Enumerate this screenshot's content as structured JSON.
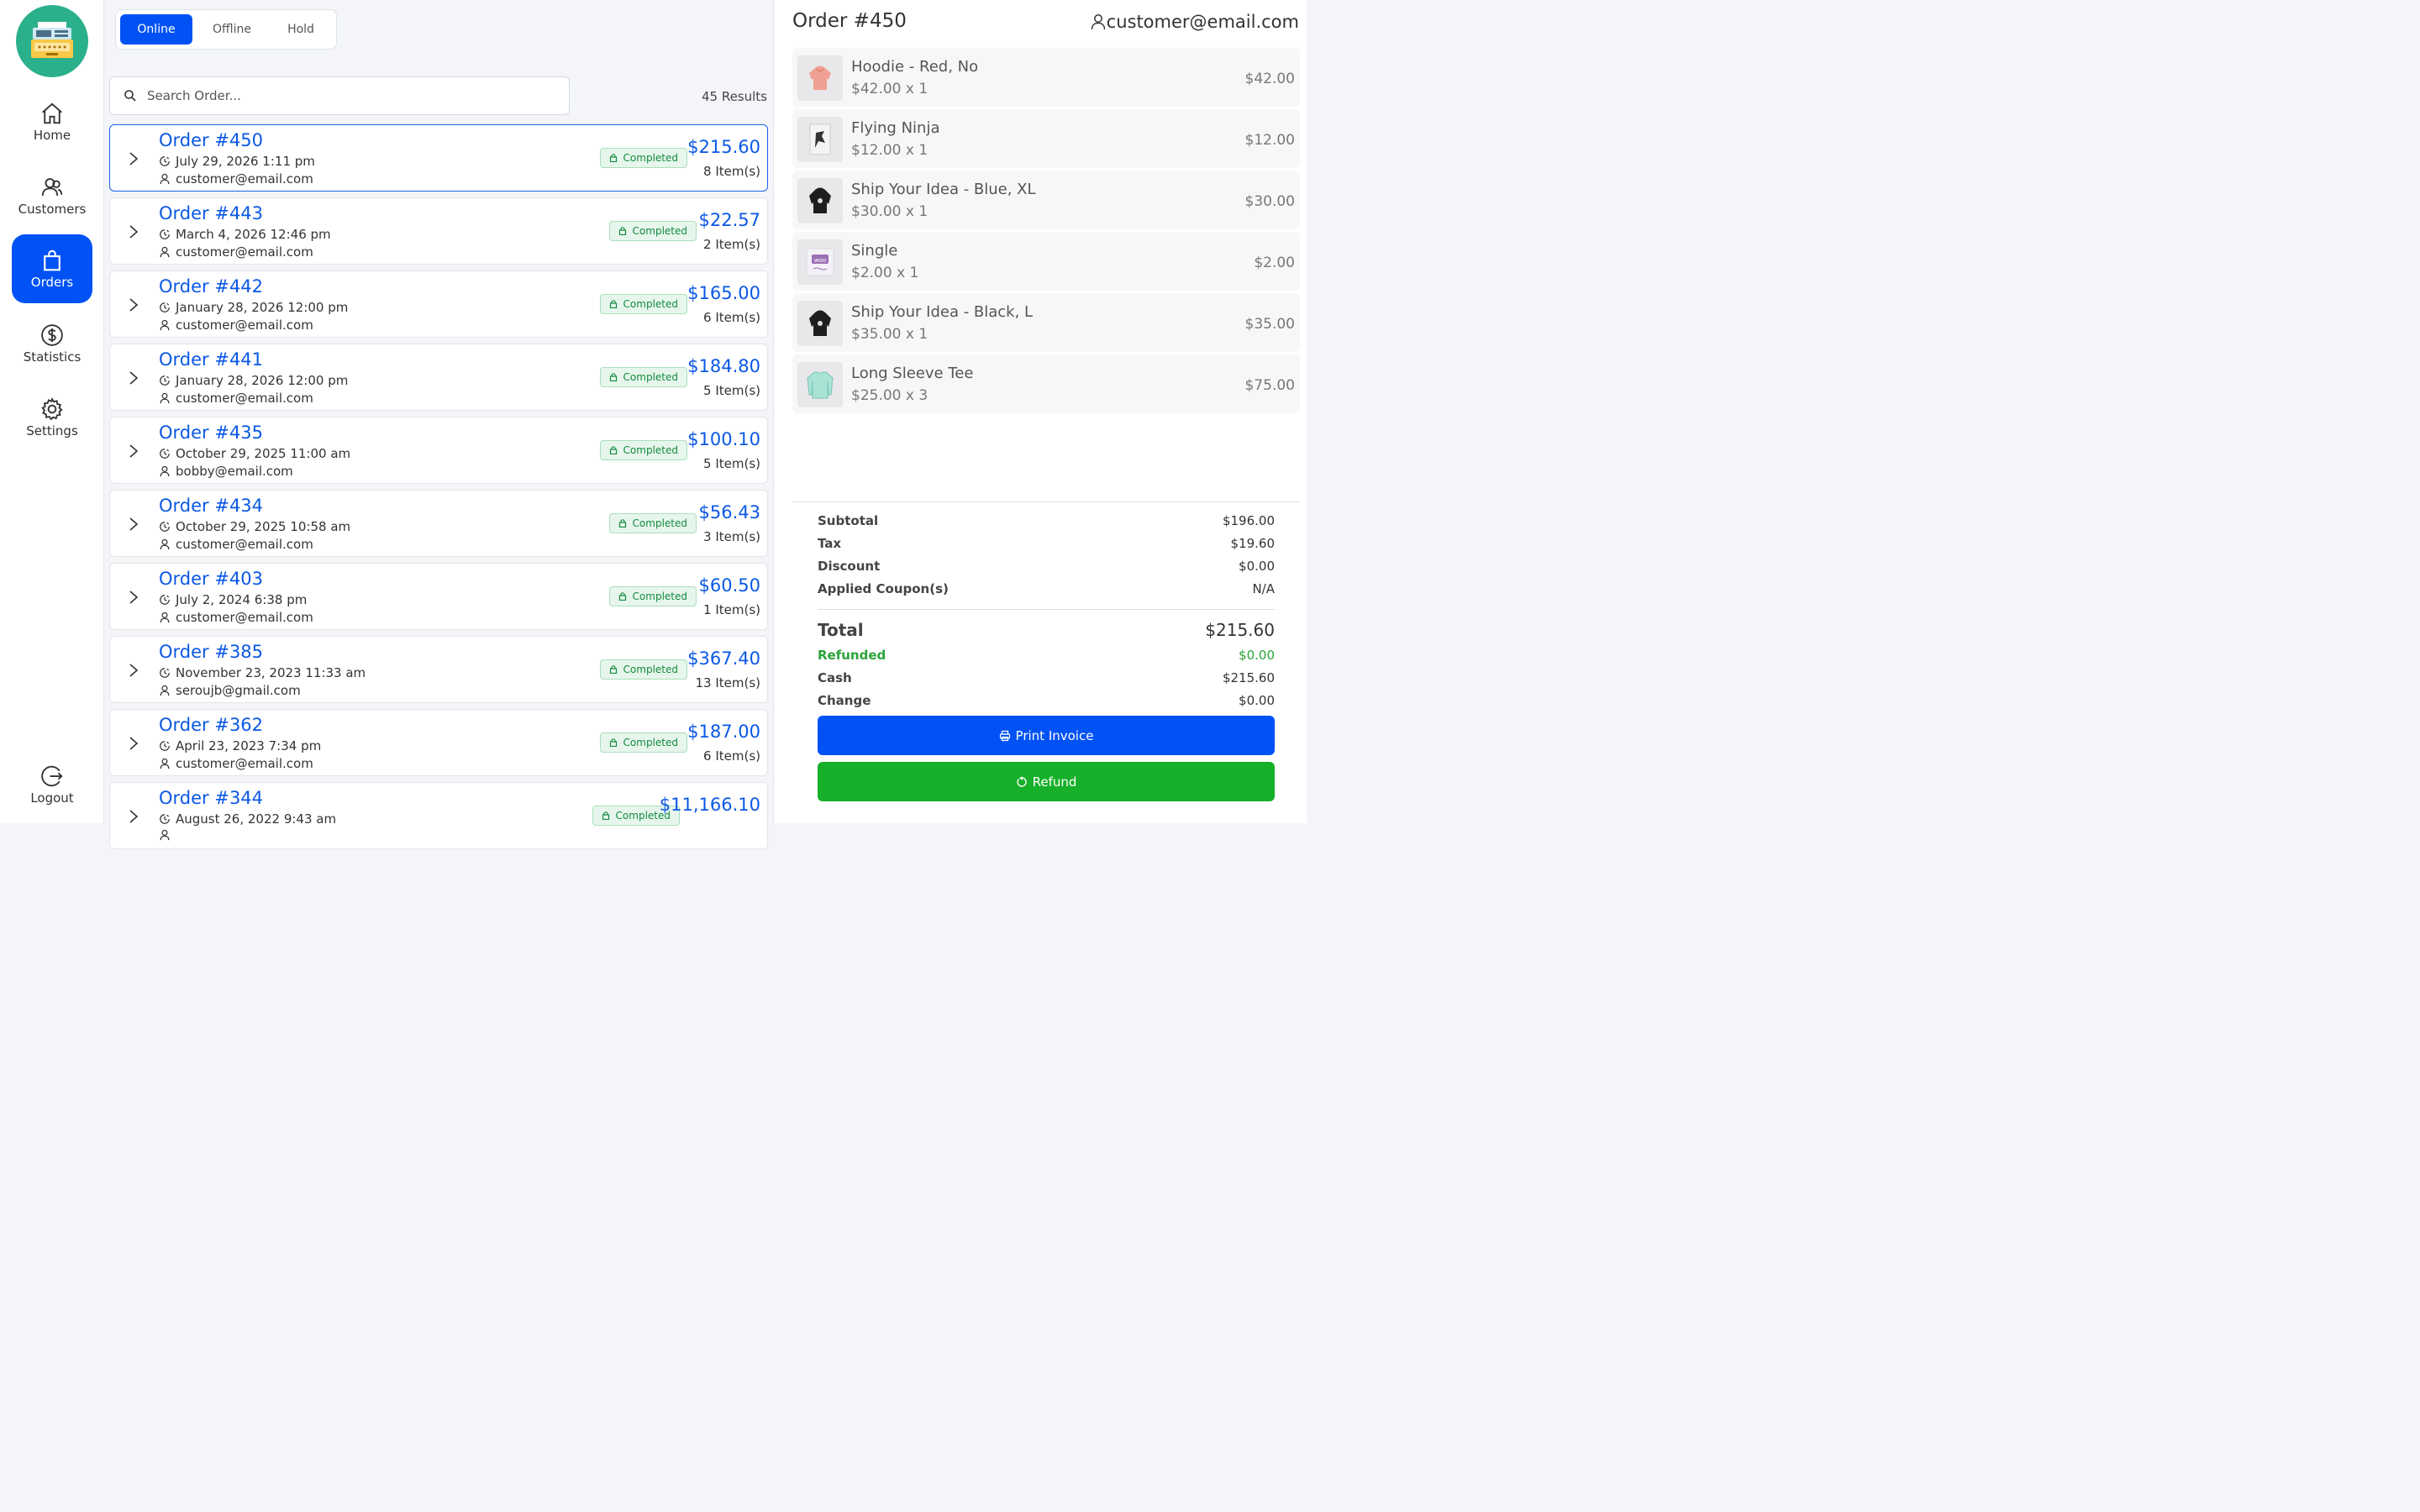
{
  "sidebar": {
    "items": [
      {
        "label": "Home",
        "icon": "home-icon"
      },
      {
        "label": "Customers",
        "icon": "users-icon"
      },
      {
        "label": "Orders",
        "icon": "bag-icon"
      },
      {
        "label": "Statistics",
        "icon": "dollar-icon"
      },
      {
        "label": "Settings",
        "icon": "gear-icon"
      }
    ],
    "logout": {
      "label": "Logout",
      "icon": "logout-icon"
    }
  },
  "tabs": [
    "Online",
    "Offline",
    "Hold"
  ],
  "active_tab": "Online",
  "search": {
    "placeholder": "Search Order...",
    "value": ""
  },
  "results_count": "45 Results",
  "orders": [
    {
      "title": "Order #450",
      "date": "July 29, 2026 1:11 pm",
      "customer": "customer@email.com",
      "status": "Completed",
      "total": "$215.60",
      "items": "8 Item(s)"
    },
    {
      "title": "Order #443",
      "date": "March 4, 2026 12:46 pm",
      "customer": "customer@email.com",
      "status": "Completed",
      "total": "$22.57",
      "items": "2 Item(s)"
    },
    {
      "title": "Order #442",
      "date": "January 28, 2026 12:00 pm",
      "customer": "customer@email.com",
      "status": "Completed",
      "total": "$165.00",
      "items": "6 Item(s)"
    },
    {
      "title": "Order #441",
      "date": "January 28, 2026 12:00 pm",
      "customer": "customer@email.com",
      "status": "Completed",
      "total": "$184.80",
      "items": "5 Item(s)"
    },
    {
      "title": "Order #435",
      "date": "October 29, 2025 11:00 am",
      "customer": "bobby@email.com",
      "status": "Completed",
      "total": "$100.10",
      "items": "5 Item(s)"
    },
    {
      "title": "Order #434",
      "date": "October 29, 2025 10:58 am",
      "customer": "customer@email.com",
      "status": "Completed",
      "total": "$56.43",
      "items": "3 Item(s)"
    },
    {
      "title": "Order #403",
      "date": "July 2, 2024 6:38 pm",
      "customer": "customer@email.com",
      "status": "Completed",
      "total": "$60.50",
      "items": "1 Item(s)"
    },
    {
      "title": "Order #385",
      "date": "November 23, 2023 11:33 am",
      "customer": "seroujb@gmail.com",
      "status": "Completed",
      "total": "$367.40",
      "items": "13 Item(s)"
    },
    {
      "title": "Order #362",
      "date": "April 23, 2023 7:34 pm",
      "customer": "customer@email.com",
      "status": "Completed",
      "total": "$187.00",
      "items": "6 Item(s)"
    },
    {
      "title": "Order #344",
      "date": "August 26, 2022 9:43 am",
      "customer": "",
      "status": "Completed",
      "total": "$11,166.10",
      "items": ""
    }
  ],
  "detail": {
    "title": "Order #450",
    "customer": "customer@email.com",
    "line_items": [
      {
        "name": "Hoodie - Red, No",
        "qty": "$42.00 x 1",
        "price": "$42.00",
        "thumb": "hoodie-red"
      },
      {
        "name": "Flying Ninja",
        "qty": "$12.00 x 1",
        "price": "$12.00",
        "thumb": "poster-ninja"
      },
      {
        "name": "Ship Your Idea - Blue, XL",
        "qty": "$30.00 x 1",
        "price": "$30.00",
        "thumb": "hoodie-black"
      },
      {
        "name": "Single",
        "qty": "$2.00 x 1",
        "price": "$2.00",
        "thumb": "woo-album"
      },
      {
        "name": "Ship Your Idea - Black, L",
        "qty": "$35.00 x 1",
        "price": "$35.00",
        "thumb": "hoodie-black"
      },
      {
        "name": "Long Sleeve Tee",
        "qty": "$25.00 x 3",
        "price": "$75.00",
        "thumb": "tee-teal"
      }
    ],
    "summary": {
      "subtotal": {
        "label": "Subtotal",
        "value": "$196.00"
      },
      "tax": {
        "label": "Tax",
        "value": "$19.60"
      },
      "discount": {
        "label": "Discount",
        "value": "$0.00"
      },
      "coupons": {
        "label": "Applied Coupon(s)",
        "value": "N/A"
      },
      "total": {
        "label": "Total",
        "value": "$215.60"
      },
      "refunded": {
        "label": "Refunded",
        "value": "$0.00"
      },
      "cash": {
        "label": "Cash",
        "value": "$215.60"
      },
      "change": {
        "label": "Change",
        "value": "$0.00"
      }
    },
    "print_label": "Print Invoice",
    "refund_label": "Refund"
  },
  "colors": {
    "accent": "#0052f5",
    "success": "#17b02a",
    "link": "#0a58e6",
    "badge_bg": "#e7f6ec"
  }
}
